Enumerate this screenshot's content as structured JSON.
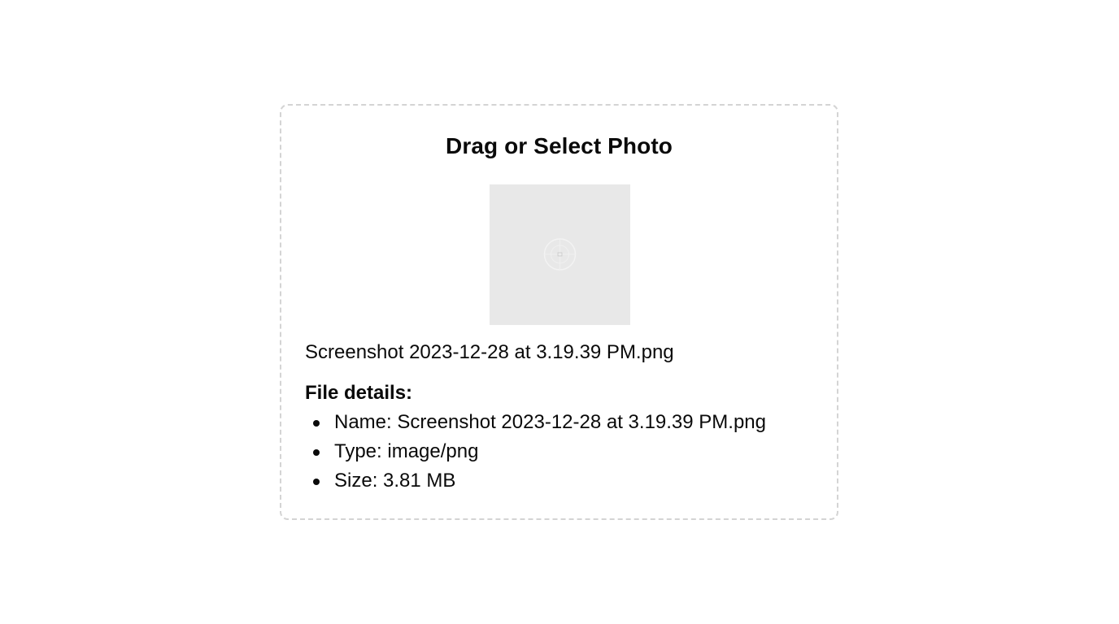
{
  "dropzone": {
    "title": "Drag or Select Photo",
    "preview_icon": "image-placeholder-icon"
  },
  "file": {
    "name": "Screenshot 2023-12-28 at 3.19.39 PM.png"
  },
  "details": {
    "heading": "File details:",
    "items": [
      {
        "text": "Name: Screenshot 2023-12-28 at 3.19.39 PM.png"
      },
      {
        "text": "Type: image/png"
      },
      {
        "text": "Size: 3.81 MB"
      }
    ]
  },
  "colors": {
    "border": "#d4d4d4",
    "preview_bg": "#e8e8e8",
    "text": "#0a0a0a"
  }
}
